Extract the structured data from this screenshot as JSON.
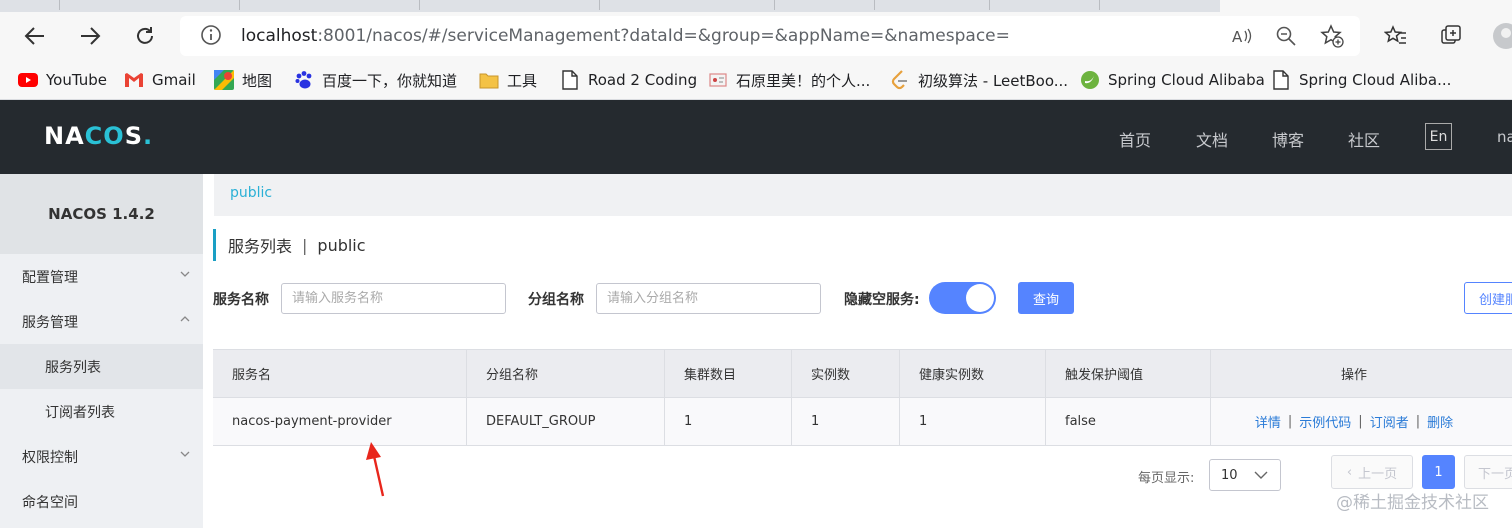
{
  "browser": {
    "url_host": "localhost",
    "url_rest": ":8001/nacos/#/serviceManagement?dataId=&group=&appName=&namespace=",
    "bookmarks": [
      {
        "label": "YouTube",
        "icon": "youtube-icon"
      },
      {
        "label": "Gmail",
        "icon": "gmail-icon"
      },
      {
        "label": "地图",
        "icon": "maps-icon"
      },
      {
        "label": "百度一下，你就知道",
        "icon": "baidu-icon"
      },
      {
        "label": "工具",
        "icon": "folder-icon"
      },
      {
        "label": "Road 2 Coding",
        "icon": "page-icon"
      },
      {
        "label": "石原里美！的个人...",
        "icon": "site-icon"
      },
      {
        "label": "初级算法 - LeetBoo...",
        "icon": "leetcode-icon"
      },
      {
        "label": "Spring Cloud Alibaba",
        "icon": "spring-icon"
      },
      {
        "label": "Spring Cloud Aliba...",
        "icon": "page-icon"
      }
    ]
  },
  "header": {
    "logo": "NACOS.",
    "nav": [
      "首页",
      "文档",
      "博客",
      "社区"
    ],
    "lang": "En",
    "user": "na"
  },
  "sidebar": {
    "version": "NACOS 1.4.2",
    "items": [
      {
        "label": "配置管理"
      },
      {
        "label": "服务管理"
      },
      {
        "label": "服务列表"
      },
      {
        "label": "订阅者列表"
      },
      {
        "label": "权限控制"
      },
      {
        "label": "命名空间"
      }
    ]
  },
  "main": {
    "namespace": "public",
    "title": "服务列表",
    "title_sep": "|",
    "title_ns": "public",
    "filters": {
      "service_label": "服务名称",
      "service_placeholder": "请输入服务名称",
      "group_label": "分组名称",
      "group_placeholder": "请输入分组名称",
      "hide_empty_label": "隐藏空服务:",
      "hide_empty_on": true,
      "query_button": "查询",
      "create_button": "创建服务"
    },
    "table": {
      "headers": [
        "服务名",
        "分组名称",
        "集群数目",
        "实例数",
        "健康实例数",
        "触发保护阈值",
        "操作"
      ],
      "rows": [
        {
          "name": "nacos-payment-provider",
          "group": "DEFAULT_GROUP",
          "clusters": "1",
          "instances": "1",
          "healthy": "1",
          "threshold": "false",
          "ops": [
            "详情",
            "示例代码",
            "订阅者",
            "删除"
          ]
        }
      ]
    },
    "pagination": {
      "per_page_label": "每页显示:",
      "per_page": "10",
      "prev": "上一页",
      "current": "1",
      "next": "下一页"
    }
  },
  "watermark": "@稀土掘金技术社区",
  "colors": {
    "accent": "#5584ff",
    "header_bg": "#252a2f",
    "link": "#2a7bd7",
    "annotation_arrow": "#e8261c"
  }
}
